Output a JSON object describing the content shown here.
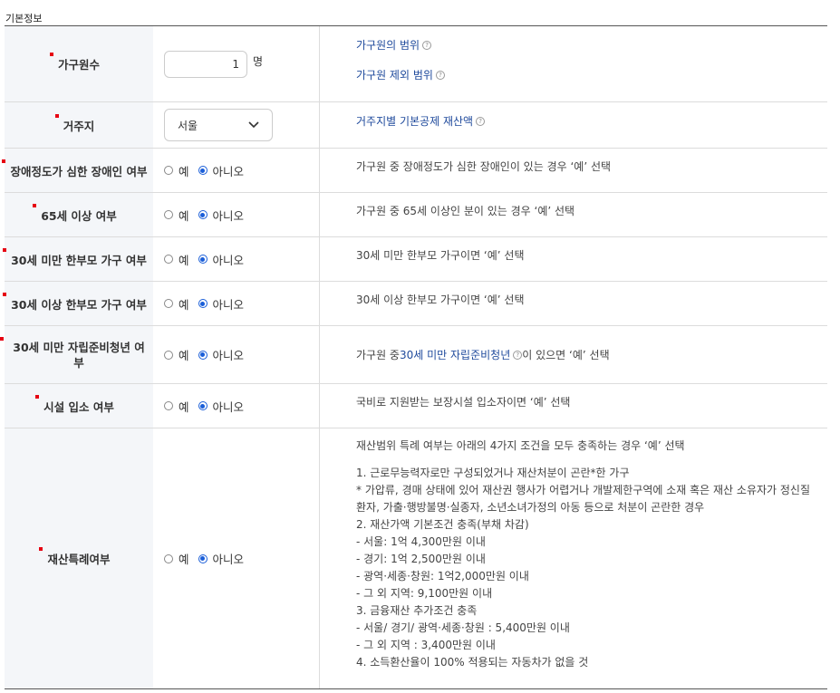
{
  "caption": "기본정보",
  "rows": [
    {
      "label": "가구원수",
      "value": "1",
      "unit": "명",
      "links": [
        "가구원의 범위",
        "가구원 제외 범위"
      ]
    },
    {
      "label": "거주지",
      "select_value": "서울",
      "link": "거주지별 기본공제 재산액"
    },
    {
      "label": "장애정도가 심한 장애인 여부",
      "yes": "예",
      "no": "아니오",
      "selected": "no",
      "desc": "가구원 중 장애정도가 심한 장애인이 있는 경우 ‘예’ 선택"
    },
    {
      "label": "65세 이상 여부",
      "yes": "예",
      "no": "아니오",
      "selected": "no",
      "desc": "가구원 중 65세 이상인 분이 있는 경우 ‘예’ 선택"
    },
    {
      "label": "30세 미만 한부모 가구 여부",
      "yes": "예",
      "no": "아니오",
      "selected": "no",
      "desc": "30세 미만 한부모 가구이면 ‘예’ 선택"
    },
    {
      "label": "30세 이상 한부모 가구 여부",
      "yes": "예",
      "no": "아니오",
      "selected": "no",
      "desc": "30세 이상 한부모 가구이면 ‘예’ 선택"
    },
    {
      "label": "30세 미만 자립준비청년 여부",
      "yes": "예",
      "no": "아니오",
      "selected": "no",
      "desc_pre": "가구원 중 ",
      "desc_link": "30세 미만 자립준비청년",
      "desc_post": "이 있으면 ‘예’ 선택"
    },
    {
      "label": "시설 입소 여부",
      "yes": "예",
      "no": "아니오",
      "selected": "no",
      "desc": "국비로 지원받는 보장시설 입소자이면 ‘예’ 선택"
    },
    {
      "label": "재산특례여부",
      "yes": "예",
      "no": "아니오",
      "selected": "no",
      "intro": "재산범위 특례 여부는 아래의 4가지 조건을 모두 충족하는 경우 ‘예’ 선택",
      "lines": [
        "1. 근로무능력자로만 구성되었거나 재산처분이 곤란*한 가구",
        "* 가압류, 경매 상태에 있어 재산권 행사가 어렵거나 개발제한구역에 소재 혹은 재산 소유자가 정신질",
        "환자, 가출·행방불명·실종자, 소년소녀가정의 아동 등으로 처분이 곤란한 경우",
        "2. 재산가액 기본조건 충족(부채 차감)",
        "- 서울: 1억 4,300만원 이내",
        "- 경기: 1억 2,500만원 이내",
        "- 광역·세종·창원: 1억2,000만원 이내",
        "- 그 외 지역: 9,100만원 이내",
        "3. 금융재산 추가조건 충족",
        "- 서울/ 경기/ 광역·세종·창원 : 5,400만원 이내",
        "- 그 외 지역 : 3,400만원 이내",
        "4. 소득환산율이 100% 적용되는 자동차가 없을 것"
      ]
    }
  ]
}
